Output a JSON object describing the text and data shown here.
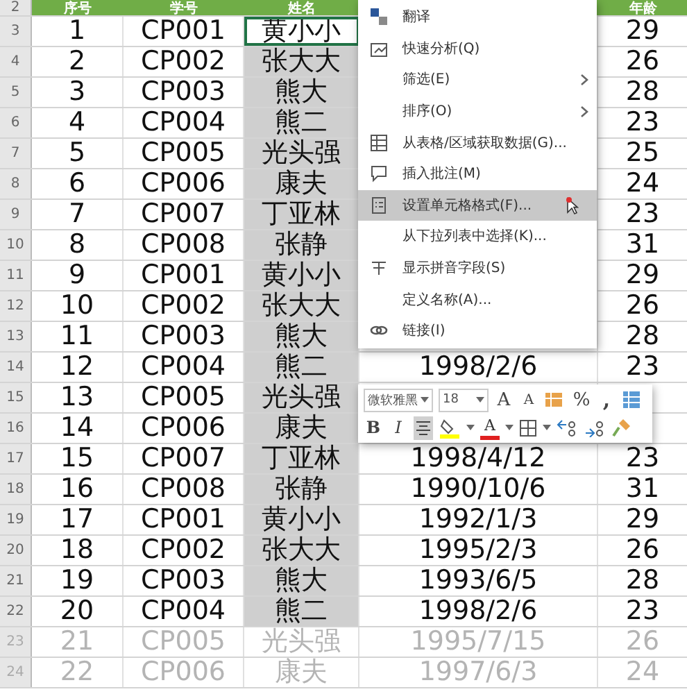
{
  "header": {
    "row_number": "2",
    "columns": [
      "序号",
      "学号",
      "姓名",
      "年龄"
    ]
  },
  "rows": [
    {
      "row_number": "3",
      "no": "1",
      "id": "CP001",
      "name": "黄小小",
      "age": "29",
      "selected": false,
      "faded": false
    },
    {
      "row_number": "4",
      "no": "2",
      "id": "CP002",
      "name": "张大大",
      "age": "26",
      "selected": true,
      "faded": false
    },
    {
      "row_number": "5",
      "no": "3",
      "id": "CP003",
      "name": "熊大",
      "age": "28",
      "selected": true,
      "faded": false
    },
    {
      "row_number": "6",
      "no": "4",
      "id": "CP004",
      "name": "熊二",
      "age": "23",
      "selected": true,
      "faded": false
    },
    {
      "row_number": "7",
      "no": "5",
      "id": "CP005",
      "name": "光头强",
      "age": "25",
      "selected": true,
      "faded": false
    },
    {
      "row_number": "8",
      "no": "6",
      "id": "CP006",
      "name": "康夫",
      "age": "24",
      "selected": true,
      "faded": false
    },
    {
      "row_number": "9",
      "no": "7",
      "id": "CP007",
      "name": "丁亚林",
      "age": "23",
      "selected": true,
      "faded": false
    },
    {
      "row_number": "10",
      "no": "8",
      "id": "CP008",
      "name": "张静",
      "age": "31",
      "selected": true,
      "faded": false
    },
    {
      "row_number": "11",
      "no": "9",
      "id": "CP001",
      "name": "黄小小",
      "age": "29",
      "selected": true,
      "faded": false
    },
    {
      "row_number": "12",
      "no": "10",
      "id": "CP002",
      "name": "张大大",
      "age": "26",
      "selected": true,
      "faded": false
    },
    {
      "row_number": "13",
      "no": "11",
      "id": "CP003",
      "name": "熊大",
      "age": "28",
      "selected": true,
      "faded": false
    },
    {
      "row_number": "14",
      "no": "12",
      "id": "CP004",
      "name": "熊二",
      "date": "1998/2/6",
      "age": "23",
      "selected": true,
      "faded": false
    },
    {
      "row_number": "15",
      "no": "13",
      "id": "CP005",
      "name": "光头强",
      "selected": true,
      "faded": false
    },
    {
      "row_number": "16",
      "no": "14",
      "id": "CP006",
      "name": "康夫",
      "selected": true,
      "faded": false
    },
    {
      "row_number": "17",
      "no": "15",
      "id": "CP007",
      "name": "丁亚林",
      "date": "1998/4/12",
      "age": "23",
      "selected": true,
      "faded": false
    },
    {
      "row_number": "18",
      "no": "16",
      "id": "CP008",
      "name": "张静",
      "date": "1990/10/6",
      "age": "31",
      "selected": true,
      "faded": false
    },
    {
      "row_number": "19",
      "no": "17",
      "id": "CP001",
      "name": "黄小小",
      "date": "1992/1/3",
      "age": "29",
      "selected": true,
      "faded": false
    },
    {
      "row_number": "20",
      "no": "18",
      "id": "CP002",
      "name": "张大大",
      "date": "1995/2/3",
      "age": "26",
      "selected": true,
      "faded": false
    },
    {
      "row_number": "21",
      "no": "19",
      "id": "CP003",
      "name": "熊大",
      "date": "1993/6/5",
      "age": "28",
      "selected": true,
      "faded": false
    },
    {
      "row_number": "22",
      "no": "20",
      "id": "CP004",
      "name": "熊二",
      "date": "1998/2/6",
      "age": "23",
      "selected": true,
      "faded": false
    },
    {
      "row_number": "23",
      "no": "21",
      "id": "CP005",
      "name": "光头强",
      "date": "1995/7/15",
      "age": "26",
      "selected": false,
      "faded": true
    },
    {
      "row_number": "24",
      "no": "22",
      "id": "CP006",
      "name": "康夫",
      "date": "1997/6/3",
      "age": "24",
      "selected": false,
      "faded": true
    }
  ],
  "context_menu": {
    "items": [
      {
        "label": "翻译",
        "submenu": false,
        "selected": false
      },
      {
        "label": "快速分析(Q)",
        "submenu": false,
        "selected": false
      },
      {
        "label": "筛选(E)",
        "submenu": true,
        "selected": false
      },
      {
        "label": "排序(O)",
        "submenu": true,
        "selected": false
      },
      {
        "label": "从表格/区域获取数据(G)...",
        "submenu": false,
        "selected": false
      },
      {
        "label": "插入批注(M)",
        "submenu": false,
        "selected": false
      },
      {
        "label": "设置单元格格式(F)...",
        "submenu": false,
        "selected": true
      },
      {
        "label": "从下拉列表中选择(K)...",
        "submenu": false,
        "selected": false
      },
      {
        "label": "显示拼音字段(S)",
        "submenu": false,
        "selected": false
      },
      {
        "label": "定义名称(A)...",
        "submenu": false,
        "selected": false
      },
      {
        "label": "链接(I)",
        "submenu": false,
        "selected": false
      }
    ]
  },
  "mini_toolbar": {
    "font": "微软雅黑",
    "size": "18",
    "grow": "A",
    "shrink": "A",
    "percent": "%",
    "comma": ",",
    "bold": "B",
    "italic": "I",
    "font_color": "A",
    "center_selected": true
  }
}
